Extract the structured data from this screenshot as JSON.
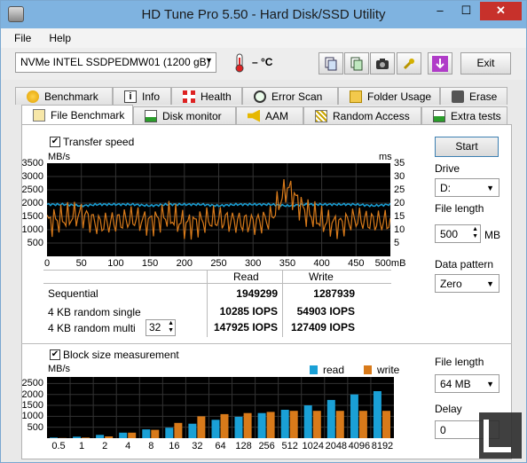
{
  "window": {
    "title": "HD Tune Pro 5.50 - Hard Disk/SSD Utility",
    "min": "–",
    "max": "☐",
    "close": "✕"
  },
  "menu": {
    "file": "File",
    "help": "Help"
  },
  "toolbar": {
    "drive": "NVMe    INTEL SSDPEDMW01 (1200 gB)",
    "temperature": "– °C",
    "exit": "Exit"
  },
  "tabs_row1": [
    "Benchmark",
    "Info",
    "Health",
    "Error Scan",
    "Folder Usage",
    "Erase"
  ],
  "tabs_row2": [
    "File Benchmark",
    "Disk monitor",
    "AAM",
    "Random Access",
    "Extra tests"
  ],
  "transfer": {
    "checkbox_label": "Transfer speed",
    "left_unit": "MB/s",
    "right_unit": "ms",
    "left_ticks": [
      "3500",
      "3000",
      "2500",
      "2000",
      "1500",
      "1000",
      "500"
    ],
    "right_ticks": [
      "35",
      "30",
      "25",
      "20",
      "15",
      "10",
      "5"
    ],
    "x_ticks": [
      "0",
      "50",
      "100",
      "150",
      "200",
      "250",
      "300",
      "350",
      "400",
      "450",
      "500mB"
    ]
  },
  "results": {
    "col_read": "Read",
    "col_write": "Write",
    "rows": [
      {
        "label": "Sequential",
        "read": "1949299",
        "write": "1287939"
      },
      {
        "label": "4 KB random single",
        "read": "10285 IOPS",
        "write": "54903 IOPS"
      },
      {
        "label": "4 KB random multi",
        "read": "147925 IOPS",
        "write": "127409 IOPS"
      }
    ],
    "multi_value": "32"
  },
  "block": {
    "checkbox_label": "Block size measurement",
    "unit": "MB/s",
    "y_ticks": [
      "2500",
      "2000",
      "1500",
      "1000",
      "500"
    ],
    "legend_read": "read",
    "legend_write": "write",
    "read_color": "#1aa0d6",
    "write_color": "#d87a1a"
  },
  "side": {
    "start": "Start",
    "drive_label": "Drive",
    "drive_value": "D:",
    "file_length_label": "File length",
    "file_length_value": "500",
    "file_length_unit": "MB",
    "pattern_label": "Data pattern",
    "pattern_value": "Zero",
    "file_length2_label": "File length",
    "file_length2_value": "64 MB",
    "delay_label": "Delay",
    "delay_value": "0"
  },
  "chart_data": [
    {
      "type": "line",
      "ylabel": "MB/s",
      "y2label": "ms",
      "xlim": [
        0,
        500
      ],
      "ylim": [
        0,
        3500
      ],
      "y2lim": [
        0,
        35
      ],
      "x_tick_labels": [
        "0",
        "50",
        "100",
        "150",
        "200",
        "250",
        "300",
        "350",
        "400",
        "450",
        "500mB"
      ],
      "series": [
        {
          "color": "#1aa0d6",
          "x": [
            0,
            25,
            50,
            75,
            100,
            125,
            150,
            175,
            200,
            225,
            250,
            275,
            300,
            325,
            350,
            375,
            400,
            425,
            450,
            475,
            500
          ],
          "y": [
            1950,
            1950,
            1900,
            1950,
            1950,
            1950,
            1900,
            1950,
            1950,
            1950,
            1900,
            1950,
            1950,
            1950,
            1900,
            1950,
            1950,
            1950,
            1950,
            1900,
            1950
          ]
        },
        {
          "color": "#d87a1a",
          "x": [
            0,
            25,
            50,
            75,
            100,
            125,
            150,
            175,
            200,
            225,
            250,
            275,
            300,
            325,
            350,
            375,
            400,
            425,
            450,
            475,
            500
          ],
          "y": [
            1300,
            1400,
            1600,
            1200,
            1300,
            1400,
            1300,
            1500,
            1200,
            1300,
            1400,
            1300,
            1250,
            1400,
            2600,
            1700,
            1300,
            1200,
            1400,
            1300,
            1300
          ]
        }
      ]
    },
    {
      "type": "bar",
      "ylabel": "MB/s",
      "ylim": [
        0,
        2800
      ],
      "categories": [
        "0.5",
        "1",
        "2",
        "4",
        "8",
        "16",
        "32",
        "64",
        "128",
        "256",
        "512",
        "1024",
        "2048",
        "4096",
        "8192"
      ],
      "series": [
        {
          "name": "read",
          "values": [
            30,
            70,
            150,
            250,
            400,
            480,
            660,
            840,
            980,
            1150,
            1300,
            1500,
            1750,
            2000,
            2150
          ]
        },
        {
          "name": "write",
          "values": [
            10,
            30,
            80,
            250,
            380,
            700,
            1000,
            1100,
            1150,
            1200,
            1250,
            1250,
            1250,
            1250,
            1250
          ]
        }
      ]
    }
  ]
}
